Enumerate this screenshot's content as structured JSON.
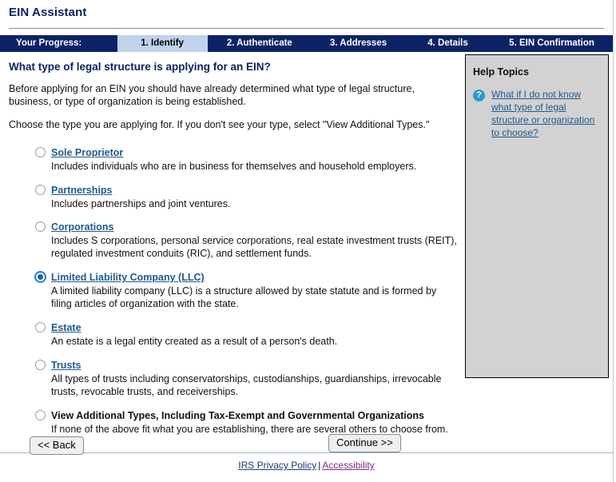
{
  "header": {
    "app_title": "EIN Assistant"
  },
  "progress": {
    "label": "Your Progress:",
    "steps": [
      {
        "label": "1. Identify",
        "active": true
      },
      {
        "label": "2. Authenticate",
        "active": false
      },
      {
        "label": "3. Addresses",
        "active": false
      },
      {
        "label": "4. Details",
        "active": false
      },
      {
        "label": "5. EIN Confirmation",
        "active": false
      }
    ]
  },
  "main": {
    "question_title": "What type of legal structure is applying for an EIN?",
    "intro_paragraph_1": "Before applying for an EIN you should have already determined what type of legal structure, business, or type of organization is being established.",
    "intro_paragraph_2": "Choose the type you are applying for. If you don't see your type, select \"View Additional Types.\"",
    "options": [
      {
        "label": "Sole Proprietor",
        "description": "Includes individuals who are in business for themselves and household employers.",
        "selected": false,
        "is_link": true
      },
      {
        "label": "Partnerships",
        "description": "Includes partnerships and joint ventures.",
        "selected": false,
        "is_link": true
      },
      {
        "label": "Corporations",
        "description": "Includes S corporations, personal service corporations, real estate investment trusts (REIT), regulated investment conduits (RIC), and settlement funds.",
        "selected": false,
        "is_link": true
      },
      {
        "label": "Limited Liability Company (LLC)",
        "description": "A limited liability company (LLC) is a structure allowed by state statute and is formed by filing articles of organization with the state.",
        "selected": true,
        "is_link": true
      },
      {
        "label": "Estate",
        "description": "An estate is a legal entity created as a result of a person's death.",
        "selected": false,
        "is_link": true
      },
      {
        "label": "Trusts",
        "description": "All types of trusts including conservatorships, custodianships, guardianships, irrevocable trusts, revocable trusts, and receiverships.",
        "selected": false,
        "is_link": true
      },
      {
        "label": "View Additional Types, Including Tax-Exempt and Governmental Organizations",
        "description": "If none of the above fit what you are establishing, there are several others to choose from.",
        "selected": false,
        "is_link": false
      }
    ]
  },
  "help": {
    "title": "Help Topics",
    "icon": "question-mark-icon",
    "icon_glyph": "?",
    "link_text": "What if I do not know what type of legal structure or organization to choose?"
  },
  "buttons": {
    "back_label": "<< Back",
    "continue_label": "Continue >>"
  },
  "footer": {
    "privacy_label": "IRS Privacy Policy",
    "separator": "|",
    "accessibility_label": "Accessibility"
  },
  "colors": {
    "navy": "#0b2265",
    "active_tab": "#bfd3ea",
    "link_blue": "#1f5a8f",
    "visited_purple": "#7b2a84",
    "help_panel_bg": "#d2d2d2",
    "help_icon_blue": "#2e97d4",
    "selected_radio": "#1162b5"
  }
}
